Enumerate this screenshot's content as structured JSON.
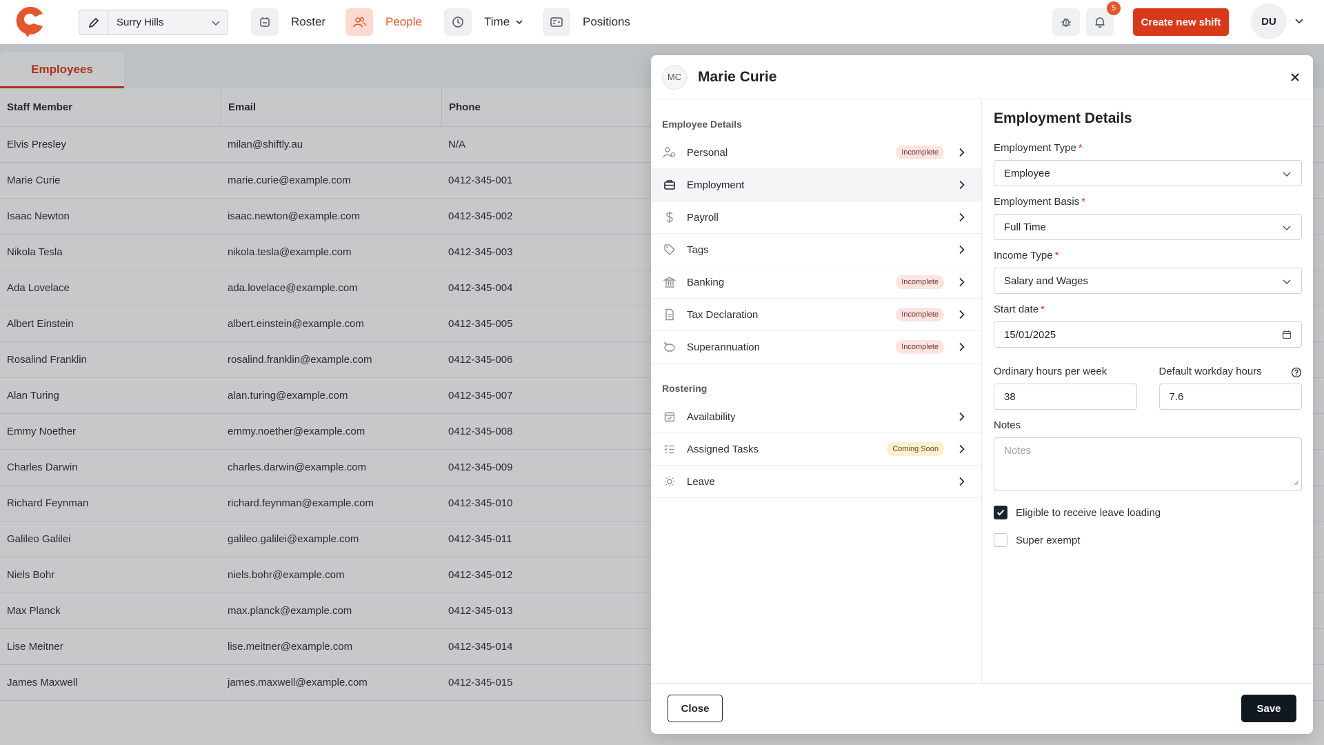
{
  "app": {
    "brand_color": "#e4572e",
    "accent_color": "#d8391a"
  },
  "topnav": {
    "location": "Surry Hills",
    "items": [
      {
        "label": "Roster",
        "icon": "calendar-icon"
      },
      {
        "label": "People",
        "icon": "people-icon",
        "active": true
      },
      {
        "label": "Time",
        "icon": "clock-icon"
      },
      {
        "label": "Positions",
        "icon": "id-card-icon"
      }
    ],
    "notification_count": "5",
    "create_label": "Create new shift",
    "user_initials": "DU"
  },
  "employees": {
    "tab_label": "Employees",
    "columns": [
      "Staff Member",
      "Email",
      "Phone"
    ],
    "rows": [
      [
        "Elvis Presley",
        "milan@shiftly.au",
        "N/A"
      ],
      [
        "Marie Curie",
        "marie.curie@example.com",
        "0412-345-001"
      ],
      [
        "Isaac Newton",
        "isaac.newton@example.com",
        "0412-345-002"
      ],
      [
        "Nikola Tesla",
        "nikola.tesla@example.com",
        "0412-345-003"
      ],
      [
        "Ada Lovelace",
        "ada.lovelace@example.com",
        "0412-345-004"
      ],
      [
        "Albert Einstein",
        "albert.einstein@example.com",
        "0412-345-005"
      ],
      [
        "Rosalind Franklin",
        "rosalind.franklin@example.com",
        "0412-345-006"
      ],
      [
        "Alan Turing",
        "alan.turing@example.com",
        "0412-345-007"
      ],
      [
        "Emmy Noether",
        "emmy.noether@example.com",
        "0412-345-008"
      ],
      [
        "Charles Darwin",
        "charles.darwin@example.com",
        "0412-345-009"
      ],
      [
        "Richard Feynman",
        "richard.feynman@example.com",
        "0412-345-010"
      ],
      [
        "Galileo Galilei",
        "galileo.galilei@example.com",
        "0412-345-011"
      ],
      [
        "Niels Bohr",
        "niels.bohr@example.com",
        "0412-345-012"
      ],
      [
        "Max Planck",
        "max.planck@example.com",
        "0412-345-013"
      ],
      [
        "Lise Meitner",
        "lise.meitner@example.com",
        "0412-345-014"
      ],
      [
        "James Maxwell",
        "james.maxwell@example.com",
        "0412-345-015"
      ]
    ]
  },
  "modal": {
    "initials": "MC",
    "name": "Marie Curie",
    "sections": {
      "details_title": "Employee Details",
      "rostering_title": "Rostering"
    },
    "nav": [
      {
        "label": "Personal",
        "icon": "user-settings-icon",
        "badge": "Incomplete"
      },
      {
        "label": "Employment",
        "icon": "briefcase-icon",
        "badge": "",
        "active": true
      },
      {
        "label": "Payroll",
        "icon": "dollar-icon",
        "badge": ""
      },
      {
        "label": "Tags",
        "icon": "tag-icon",
        "badge": ""
      },
      {
        "label": "Banking",
        "icon": "bank-icon",
        "badge": "Incomplete"
      },
      {
        "label": "Tax Declaration",
        "icon": "document-icon",
        "badge": "Incomplete"
      },
      {
        "label": "Superannuation",
        "icon": "piggy-bank-icon",
        "badge": "Incomplete"
      }
    ],
    "rostering_nav": [
      {
        "label": "Availability",
        "icon": "calendar-check-icon",
        "badge": ""
      },
      {
        "label": "Assigned Tasks",
        "icon": "checklist-icon",
        "badge": "Coming Soon"
      },
      {
        "label": "Leave",
        "icon": "sun-icon",
        "badge": ""
      }
    ],
    "form": {
      "title": "Employment Details",
      "employment_type_label": "Employment Type",
      "employment_type_value": "Employee",
      "employment_basis_label": "Employment Basis",
      "employment_basis_value": "Full Time",
      "income_type_label": "Income Type",
      "income_type_value": "Salary and Wages",
      "start_date_label": "Start date",
      "start_date_value": "15/01/2025",
      "ordinary_hours_label": "Ordinary hours per week",
      "ordinary_hours_value": "38",
      "workday_hours_label": "Default workday hours",
      "workday_hours_value": "7.6",
      "notes_label": "Notes",
      "notes_placeholder": "Notes",
      "leave_loading_label": "Eligible to receive leave loading",
      "leave_loading_checked": true,
      "super_exempt_label": "Super exempt",
      "super_exempt_checked": false
    },
    "footer": {
      "close_label": "Close",
      "save_label": "Save"
    }
  }
}
